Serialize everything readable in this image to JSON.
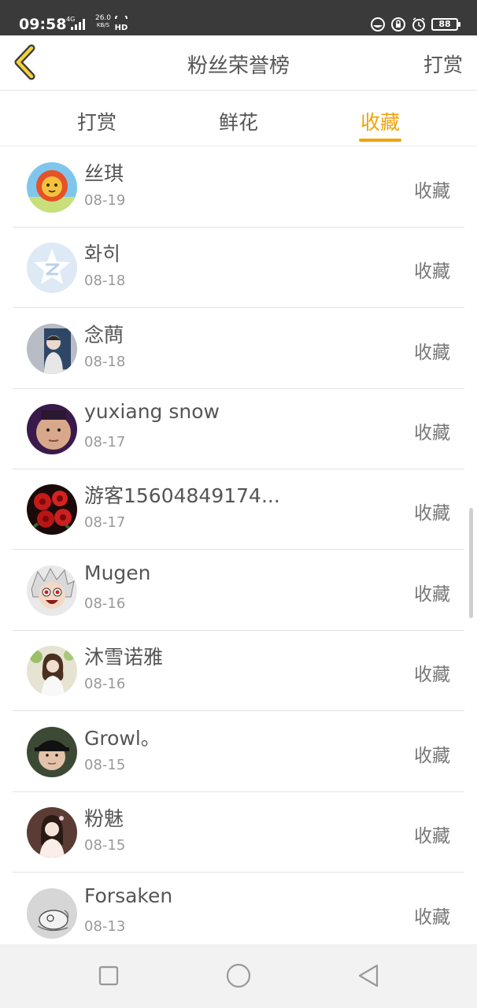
{
  "status_bar": {
    "time": "09:58",
    "network": "4G",
    "speed_value": "26.0",
    "speed_unit": "KB/S",
    "hd": "HD",
    "battery": "88"
  },
  "header": {
    "title": "粉丝荣誉榜",
    "action_label": "打赏"
  },
  "tabs": [
    {
      "label": "打赏",
      "active": false
    },
    {
      "label": "鲜花",
      "active": false
    },
    {
      "label": "收藏",
      "active": true
    }
  ],
  "colors": {
    "accent": "#f0a30a",
    "status_bar": "#3a3a3a"
  },
  "list": [
    {
      "name": "丝琪",
      "date": "08-19",
      "action": "收藏",
      "avatar": "cartoon-lion-avatar"
    },
    {
      "name": "화히",
      "date": "08-18",
      "action": "收藏",
      "avatar": "default-qzone-avatar"
    },
    {
      "name": "念蔄",
      "date": "08-18",
      "action": "收藏",
      "avatar": "photo-avatar"
    },
    {
      "name": "yuxiang snow",
      "date": "08-17",
      "action": "收藏",
      "avatar": "photo-avatar"
    },
    {
      "name": "游客15604849174...",
      "date": "08-17",
      "action": "收藏",
      "avatar": "roses-avatar"
    },
    {
      "name": "Mugen",
      "date": "08-16",
      "action": "收藏",
      "avatar": "anime-avatar"
    },
    {
      "name": "沐雪诺雅",
      "date": "08-16",
      "action": "收藏",
      "avatar": "photo-avatar"
    },
    {
      "name": "Growl。",
      "date": "08-15",
      "action": "收藏",
      "avatar": "photo-avatar"
    },
    {
      "name": "粉魅",
      "date": "08-15",
      "action": "收藏",
      "avatar": "photo-avatar"
    },
    {
      "name": "Forsaken",
      "date": "08-13",
      "action": "收藏",
      "avatar": "sketch-avatar"
    }
  ],
  "nav_bar": [
    "square-icon",
    "circle-icon",
    "triangle-back-icon"
  ]
}
